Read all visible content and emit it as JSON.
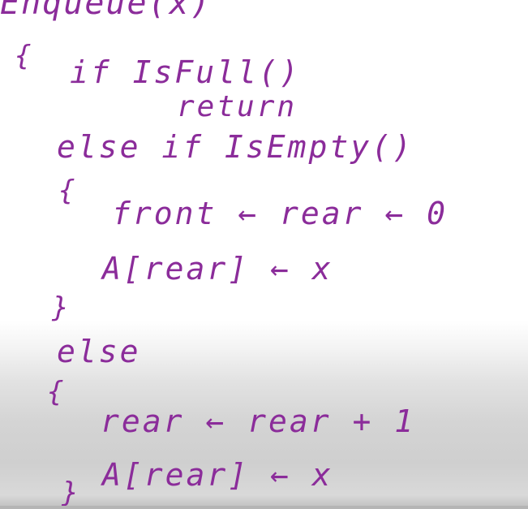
{
  "notes": {
    "title": "Enqueue(x)",
    "brace_open_1": "{",
    "if_line": "if IsFull()",
    "return_line": "return",
    "else_if_line": "else if IsEmpty()",
    "brace_open_2": "{",
    "front_line": "front ← rear ← 0",
    "assign_line_1": "A[rear] ← x",
    "brace_close_2": "}",
    "else_line": "else",
    "brace_open_3": "{",
    "rear_increment_line": "rear ← rear + 1",
    "assign_line_2": "A[rear] ← x",
    "brace_close_3": "}"
  },
  "colors": {
    "ink": "#8b2c9a",
    "background": "#ffffff"
  }
}
